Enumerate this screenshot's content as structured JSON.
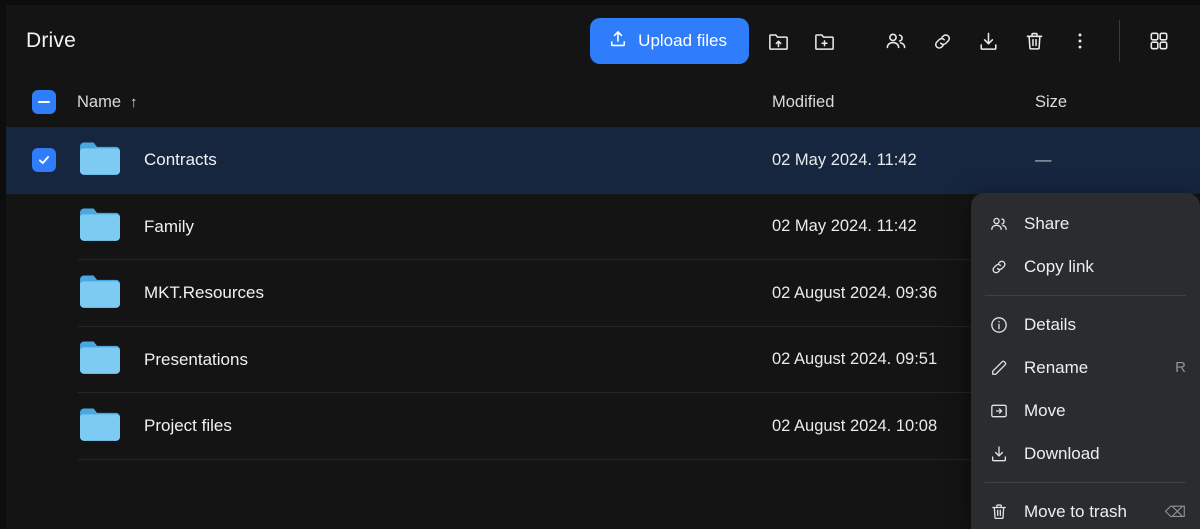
{
  "window": {
    "title": "Drive"
  },
  "toolbar": {
    "upload_label": "Upload files",
    "upload_icon": "upload-icon",
    "accent_color": "#2f7dfb",
    "actions": [
      {
        "name": "upload-folder-button",
        "icon": "folder-upload-icon",
        "label": "Upload folder"
      },
      {
        "name": "new-folder-button",
        "icon": "folder-add-icon",
        "label": "New folder"
      },
      {
        "name": "share-button",
        "icon": "people-icon",
        "label": "Share"
      },
      {
        "name": "copy-link-button",
        "icon": "link-icon",
        "label": "Copy link"
      },
      {
        "name": "download-button",
        "icon": "download-icon",
        "label": "Download"
      },
      {
        "name": "trash-button",
        "icon": "trash-icon",
        "label": "Move to trash"
      },
      {
        "name": "more-options-button",
        "icon": "kebab-menu-icon",
        "label": "More"
      },
      {
        "name": "grid-view-button",
        "icon": "grid-view-icon",
        "label": "Grid view"
      }
    ]
  },
  "columns": {
    "select_all_state": "indeterminate",
    "name": "Name",
    "sort_arrow": "↑",
    "modified": "Modified",
    "size": "Size"
  },
  "files": [
    {
      "name": "Contracts",
      "modified": "02 May 2024. 11:42",
      "size": "—",
      "selected": true,
      "icon": "folder-icon"
    },
    {
      "name": "Family",
      "modified": "02 May 2024. 11:42",
      "size": "",
      "selected": false,
      "icon": "folder-icon"
    },
    {
      "name": "MKT.Resources",
      "modified": "02 August 2024. 09:36",
      "size": "",
      "selected": false,
      "icon": "folder-icon"
    },
    {
      "name": "Presentations",
      "modified": "02 August 2024. 09:51",
      "size": "",
      "selected": false,
      "icon": "folder-icon"
    },
    {
      "name": "Project files",
      "modified": "02 August 2024. 10:08",
      "size": "",
      "selected": false,
      "icon": "folder-icon"
    }
  ],
  "context_menu": {
    "items": [
      {
        "label": "Share",
        "icon": "people-icon",
        "shortcut": ""
      },
      {
        "label": "Copy link",
        "icon": "link-icon",
        "shortcut": ""
      },
      {
        "label": "Details",
        "icon": "info-icon",
        "shortcut": ""
      },
      {
        "label": "Rename",
        "icon": "pencil-icon",
        "shortcut": "R"
      },
      {
        "label": "Move",
        "icon": "move-folder-icon",
        "shortcut": ""
      },
      {
        "label": "Download",
        "icon": "download-icon",
        "shortcut": ""
      },
      {
        "label": "Move to trash",
        "icon": "trash-icon",
        "shortcut": "⌫"
      }
    ]
  }
}
